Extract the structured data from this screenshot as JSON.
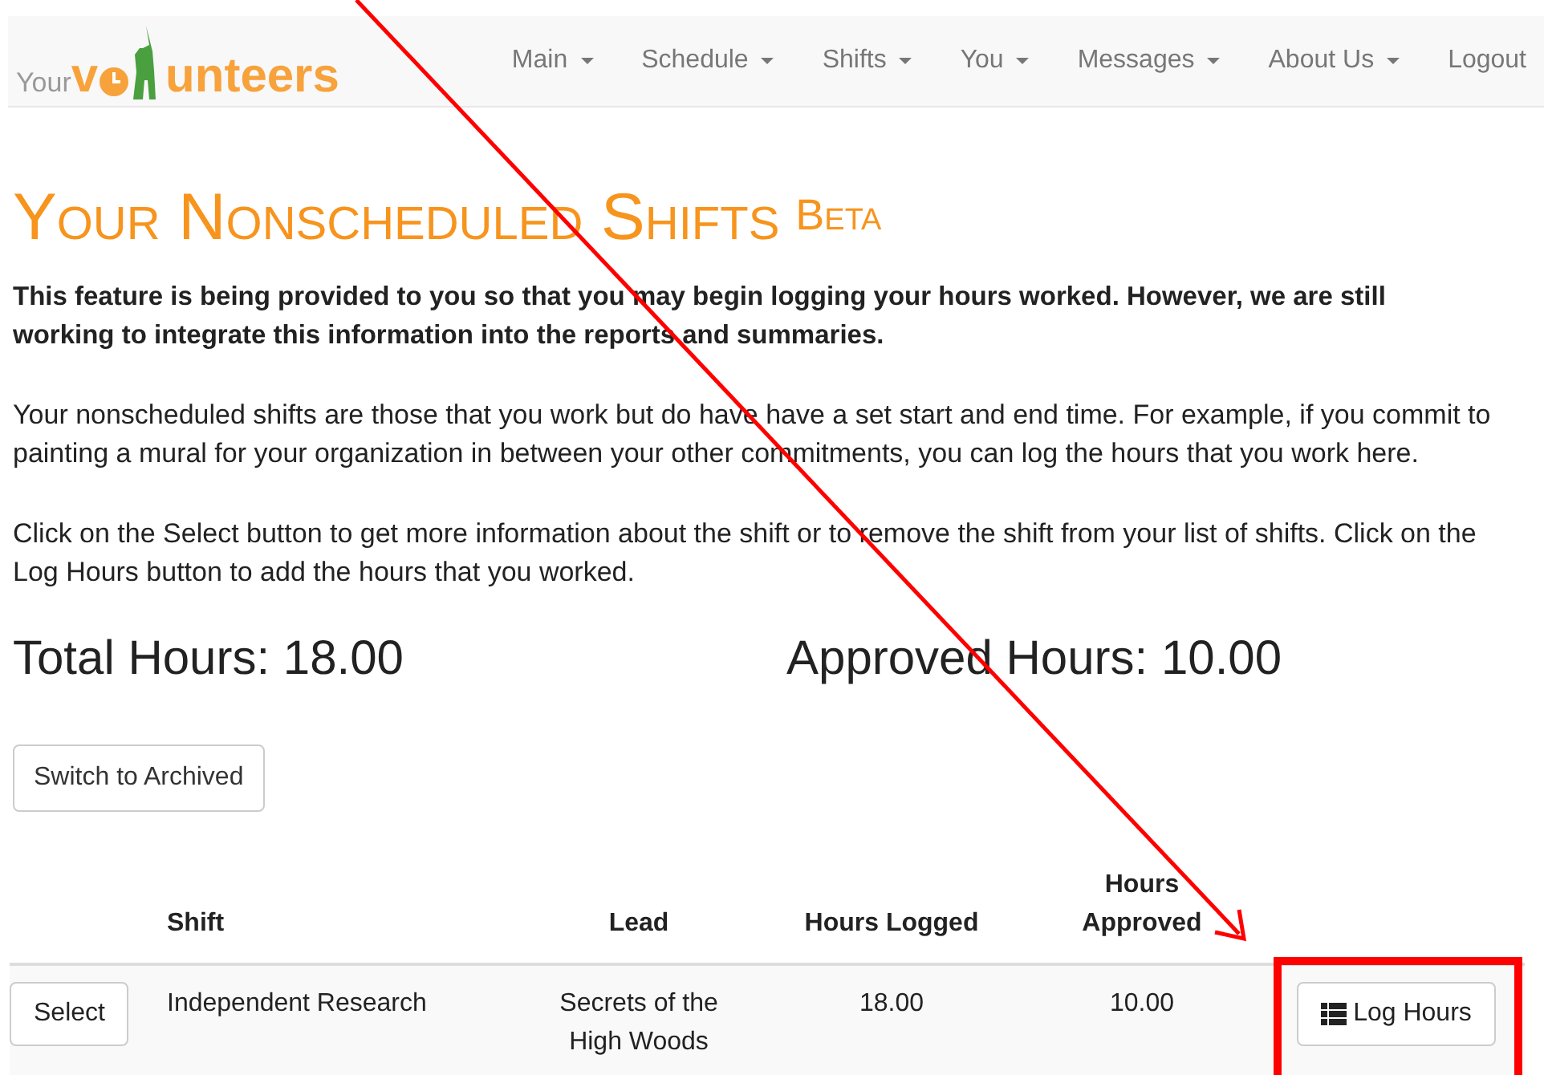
{
  "logo": {
    "prefix": "Your",
    "parts": [
      "v",
      "unteers"
    ]
  },
  "nav": [
    {
      "label": "Main",
      "dropdown": true
    },
    {
      "label": "Schedule",
      "dropdown": true
    },
    {
      "label": "Shifts",
      "dropdown": true
    },
    {
      "label": "You",
      "dropdown": true
    },
    {
      "label": "Messages",
      "dropdown": true
    },
    {
      "label": "About Us",
      "dropdown": true
    },
    {
      "label": "Logout",
      "dropdown": false
    }
  ],
  "title": "Your Nonscheduled Shifts",
  "title_badge": "Beta",
  "notice": "This feature is being provided to you so that you may begin logging your hours worked. However, we are still working to integrate this information into the reports and summaries.",
  "paragraphs": [
    "Your nonscheduled shifts are those that you work but do have have a set start and end time. For example, if you commit to painting a mural for your organization in between your other commitments, you can log the hours that you work here.",
    "Click on the Select button to get more information about the shift or to remove the shift from your list of shifts. Click on the Log Hours button to add the hours that you worked."
  ],
  "total_hours": "Total Hours: 18.00",
  "approved_hours": "Approved Hours: 10.00",
  "switch_button": "Switch to Archived",
  "table": {
    "columns": [
      "Shift",
      "Lead",
      "Hours Logged",
      "Hours Approved"
    ],
    "rows": [
      {
        "select": "Select",
        "shift": "Independent Research",
        "lead": "Secrets of the High Woods",
        "hours_logged": "18.00",
        "hours_approved": "10.00",
        "action": "Log Hours"
      }
    ]
  }
}
